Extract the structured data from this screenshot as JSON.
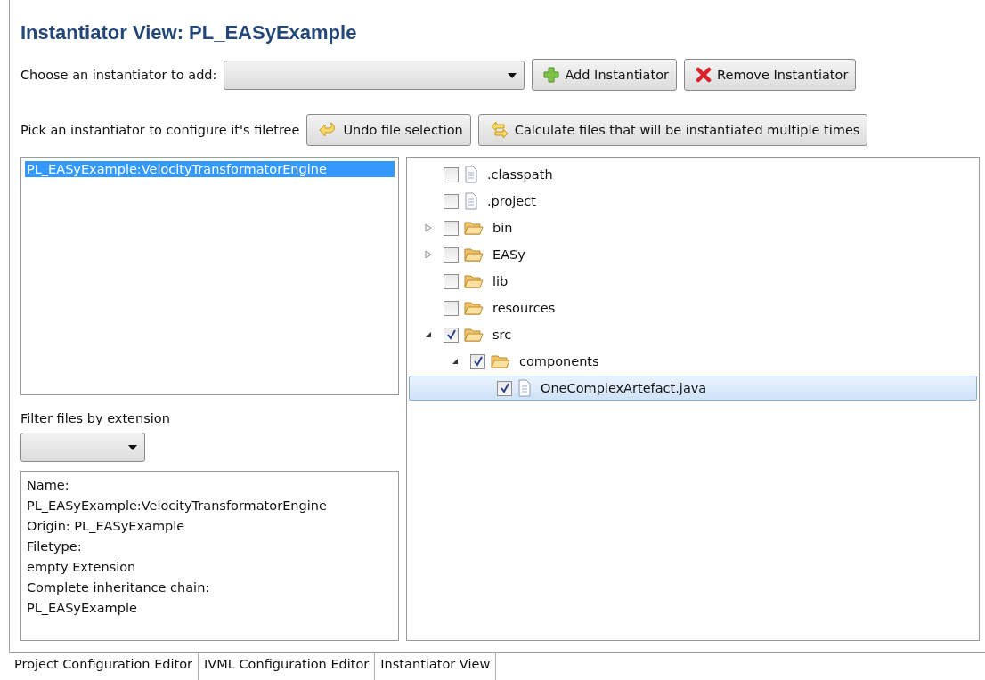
{
  "view": {
    "title": "Instantiator View: PL_EASyExample"
  },
  "add_row": {
    "label": "Choose an instantiator to add:",
    "buttons": [
      {
        "label": "Add Instantiator",
        "kind": "add"
      },
      {
        "label": "Remove Instantiator",
        "kind": "remove"
      }
    ]
  },
  "pick_row": {
    "label": "Pick an instantiator to configure it's filetree",
    "buttons": [
      {
        "label": "Undo file selection",
        "kind": "undo"
      },
      {
        "label": "Calculate files that will be instantiated multiple times",
        "kind": "calculate"
      }
    ]
  },
  "instantiators": [
    {
      "label": "PL_EASyExample:VelocityTransformatorEngine",
      "selected": true
    }
  ],
  "filter": {
    "label": "Filter files by extension"
  },
  "info_lines": [
    "Name:",
    "PL_EASyExample:VelocityTransformatorEngine",
    "Origin: PL_EASyExample",
    "Filetype:",
    "empty Extension",
    "Complete inheritance chain:",
    "PL_EASyExample"
  ],
  "file_tree": [
    {
      "name": ".classpath",
      "kind": "file",
      "checked": false,
      "selected": false
    },
    {
      "name": ".project",
      "kind": "file",
      "checked": false,
      "selected": false
    },
    {
      "name": "bin",
      "kind": "folder",
      "checked": false,
      "selected": false,
      "expanded": false
    },
    {
      "name": "EASy",
      "kind": "folder",
      "checked": false,
      "selected": false,
      "expanded": false
    },
    {
      "name": "lib",
      "kind": "folder",
      "checked": false,
      "selected": false
    },
    {
      "name": "resources",
      "kind": "folder",
      "checked": false,
      "selected": false
    },
    {
      "name": "src",
      "kind": "folder",
      "checked": true,
      "selected": false,
      "expanded": true,
      "children": [
        {
          "name": "components",
          "kind": "folder",
          "checked": true,
          "selected": false,
          "expanded": true,
          "children": [
            {
              "name": "OneComplexArtefact.java",
              "kind": "file",
              "checked": true,
              "selected": true
            }
          ]
        }
      ]
    }
  ],
  "tabs": [
    {
      "label": "Project Configuration Editor",
      "selected": false
    },
    {
      "label": "IVML Configuration Editor",
      "selected": false
    },
    {
      "label": "Instantiator View",
      "selected": true
    }
  ]
}
